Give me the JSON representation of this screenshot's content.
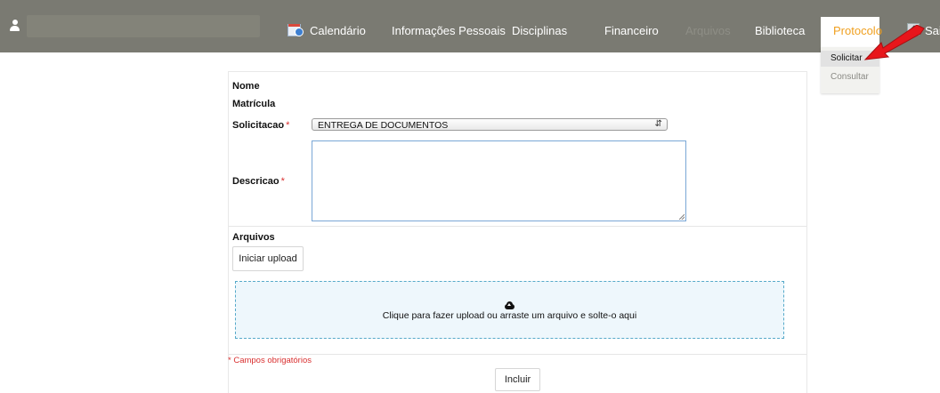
{
  "nav": {
    "items": [
      {
        "label": "Calendário"
      },
      {
        "label": "Informações Pessoais"
      },
      {
        "label": "Disciplinas"
      },
      {
        "label": "Financeiro"
      },
      {
        "label": "Arquivos"
      },
      {
        "label": "Biblioteca"
      },
      {
        "label": "Protocolo"
      },
      {
        "label": "Sai"
      }
    ],
    "active": "Protocolo",
    "active_color": "#f0a020",
    "bar_color": "#7a7a72"
  },
  "dropdown": {
    "items": [
      {
        "label": "Solicitar"
      },
      {
        "label": "Consultar"
      }
    ],
    "selected": "Solicitar"
  },
  "form": {
    "nome_label": "Nome",
    "matricula_label": "Matrícula",
    "solicitacao_label": "Solicitacao",
    "solicitacao_value": "ENTREGA DE DOCUMENTOS",
    "descricao_label": "Descricao",
    "required_marker": "*",
    "arquivos_label": "Arquivos",
    "upload_button": "Iniciar upload",
    "dropzone_text": "Clique para fazer upload ou arraste um arquivo e solte-o aqui",
    "required_note": "* Campos obrigatórios",
    "submit_button": "Incluir"
  },
  "icons": [
    "user-icon",
    "calendar-icon",
    "logout-icon",
    "cloud-upload-icon",
    "red-arrow-icon",
    "select-caret-icon"
  ]
}
